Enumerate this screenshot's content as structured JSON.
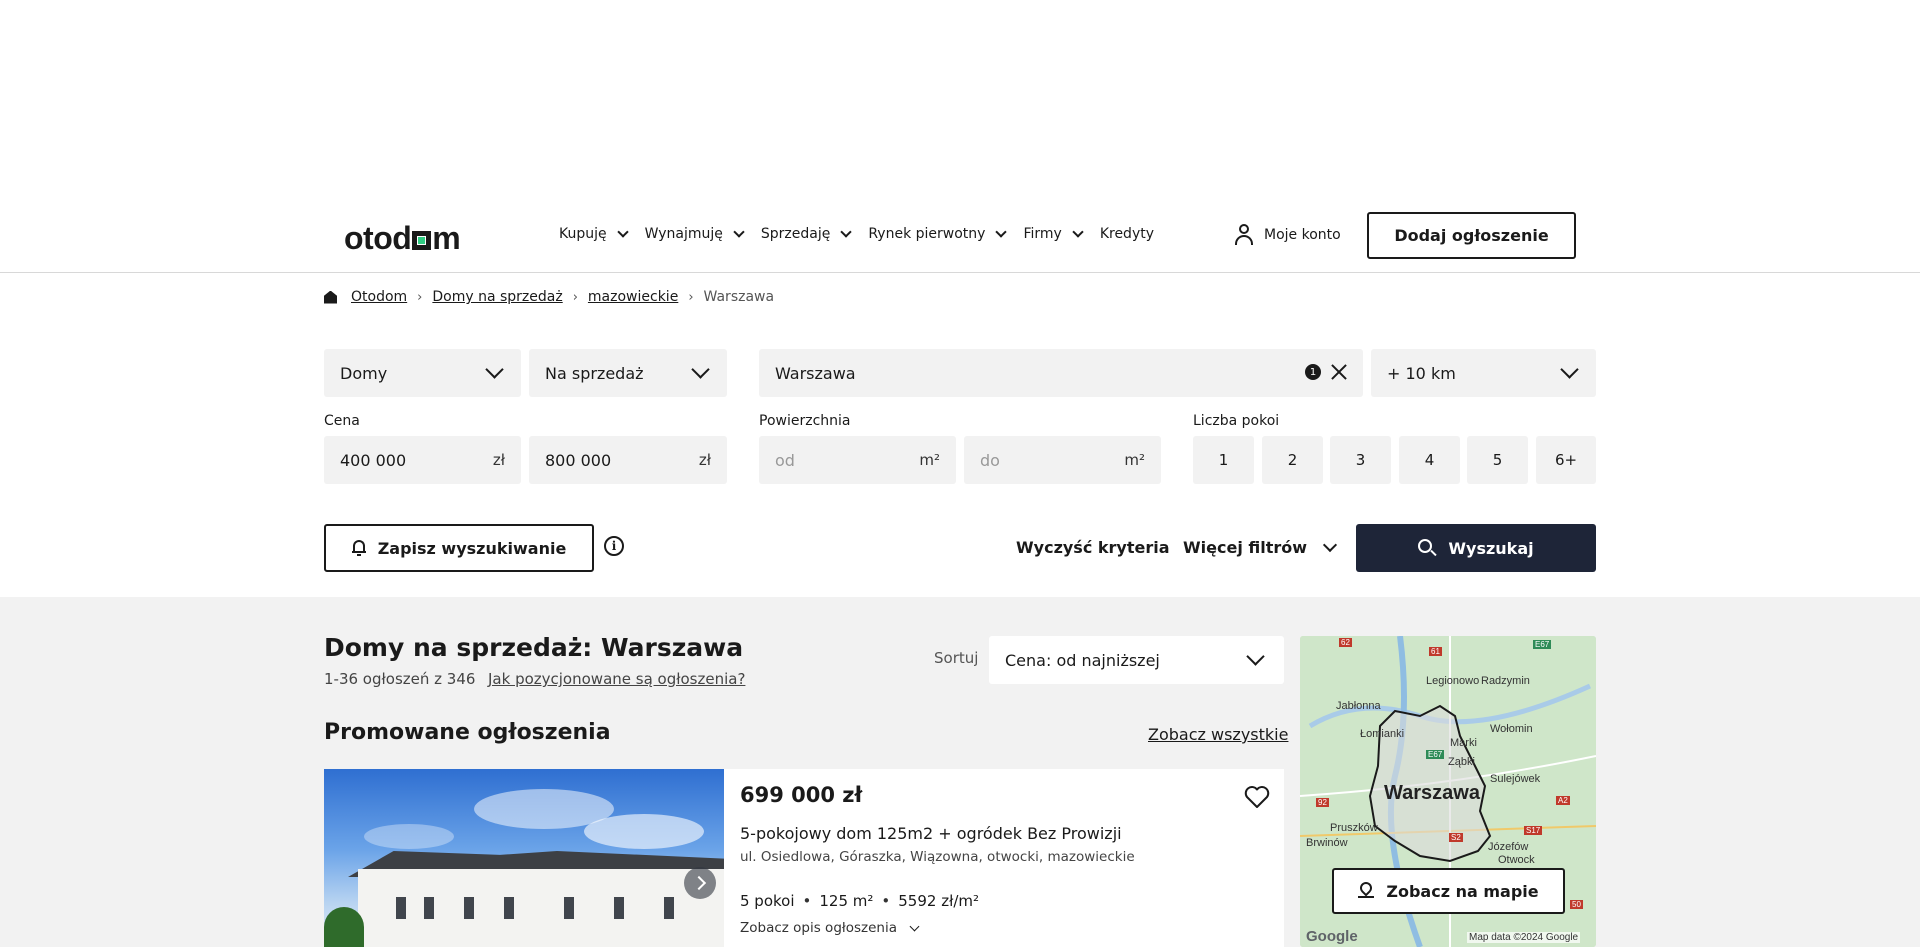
{
  "header": {
    "logo_text": "otodom",
    "nav": [
      "Kupuję",
      "Wynajmuję",
      "Sprzedaję",
      "Rynek pierwotny",
      "Firmy"
    ],
    "nav_credits": "Kredyty",
    "account_label": "Moje konto",
    "add_listing_label": "Dodaj ogłoszenie"
  },
  "breadcrumb": {
    "home": "Otodom",
    "level1": "Domy na sprzedaż",
    "level2": "mazowieckie",
    "current": "Warszawa"
  },
  "filters": {
    "property_type": "Domy",
    "transaction": "Na sprzedaż",
    "location": "Warszawa",
    "location_count": "1",
    "radius": "+ 10 km",
    "price_label": "Cena",
    "price_min": "400 000",
    "price_max": "800 000",
    "currency_unit": "zł",
    "area_label": "Powierzchnia",
    "area_min_placeholder": "od",
    "area_max_placeholder": "do",
    "area_unit": "m²",
    "rooms_label": "Liczba pokoi",
    "rooms": [
      "1",
      "2",
      "3",
      "4",
      "5",
      "6+"
    ],
    "save_search_label": "Zapisz wyszukiwanie",
    "clear_label": "Wyczyść kryteria",
    "more_filters_label": "Więcej filtrów",
    "search_label": "Wyszukaj"
  },
  "results": {
    "title": "Domy na sprzedaż: Warszawa",
    "count": "1-36 ogłoszeń z 346",
    "how_ranked": "Jak pozycjonowane są ogłoszenia?",
    "sort_label": "Sortuj",
    "sort_value": "Cena: od najniższej",
    "promoted_title": "Promowane ogłoszenia",
    "see_all": "Zobacz wszystkie"
  },
  "listing": {
    "price": "699 000 zł",
    "title": "5-pokojowy dom 125m2 + ogródek Bez Prowizji",
    "address": "ul. Osiedlowa, Góraszka, Wiązowna, otwocki, mazowieckie",
    "rooms": "5 pokoi",
    "area": "125 m²",
    "price_per_m2": "5592 zł/m²",
    "show_description": "Zobacz opis ogłoszenia"
  },
  "map": {
    "button_label": "Zobacz na mapie",
    "city_label": "Warszawa",
    "places": [
      "Legionowo",
      "Radzymin",
      "Jabłonna",
      "Łomianki",
      "Marki",
      "Ząbki",
      "Wołomin",
      "Sulejówek",
      "Pruszków",
      "Brwinów",
      "Józefów",
      "Otwock"
    ],
    "roads": [
      "62",
      "61",
      "E67",
      "E67",
      "92",
      "S2",
      "A2",
      "S17",
      "50"
    ],
    "google": "Google",
    "attribution": "Map data ©2024 Google"
  },
  "colors": {
    "brand_accent": "#31cd84",
    "primary_button": "#1e2538",
    "results_background": "#f2f2f2"
  }
}
